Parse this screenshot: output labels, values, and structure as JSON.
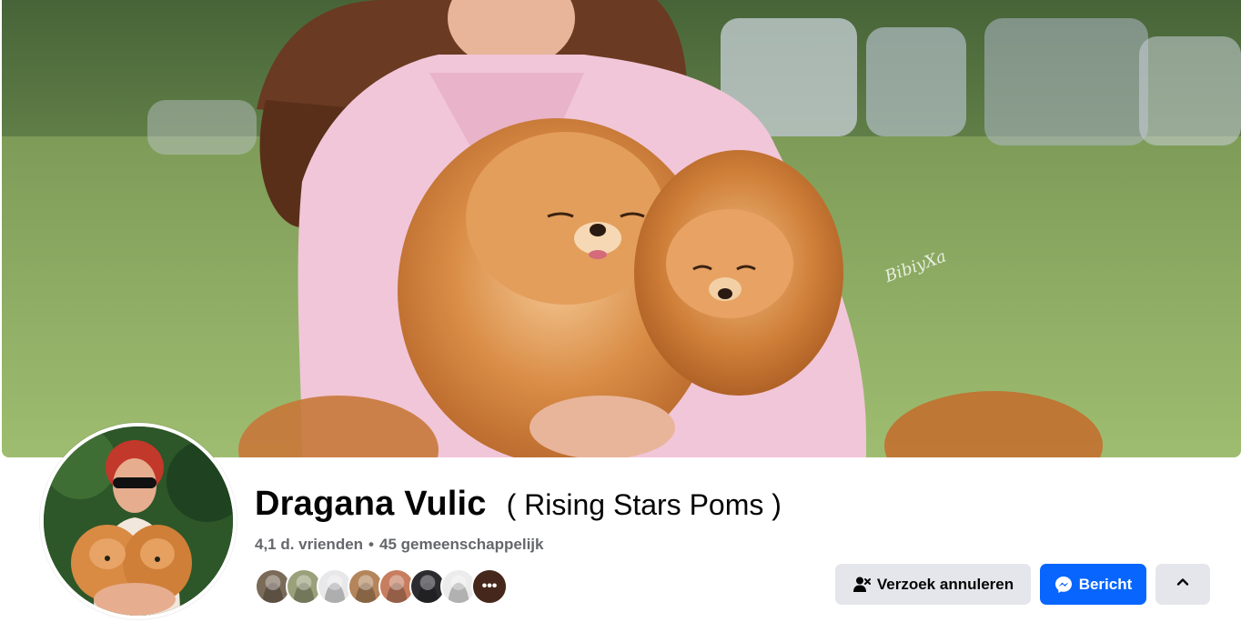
{
  "profile": {
    "name": "Dragana Vulic",
    "alternate_name": "( Rising Stars Poms )",
    "friends_count": "4,1 d. vrienden",
    "separator": "•",
    "mutual_count": "45 gemeenschappelijk",
    "cover_watermark": "BibiyXa"
  },
  "friend_faces": [
    {
      "icon": "friend-avatar",
      "color": "#7a6a58"
    },
    {
      "icon": "friend-avatar",
      "color": "#9aa07a"
    },
    {
      "icon": "friend-avatar",
      "color": "#e8e8ea"
    },
    {
      "icon": "friend-avatar",
      "color": "#b4855a"
    },
    {
      "icon": "friend-avatar",
      "color": "#c77d5f"
    },
    {
      "icon": "friend-avatar",
      "color": "#2c2c30"
    },
    {
      "icon": "friend-avatar",
      "color": "#ececec"
    }
  ],
  "more_faces_label": "•••",
  "actions": {
    "cancel_request_label": "Verzoek annuleren",
    "message_label": "Bericht",
    "collapse_icon": "chevron-up-icon"
  },
  "colors": {
    "primary_button": "#0866ff",
    "secondary_button": "#e4e6eb",
    "meta_text": "#65676b"
  }
}
